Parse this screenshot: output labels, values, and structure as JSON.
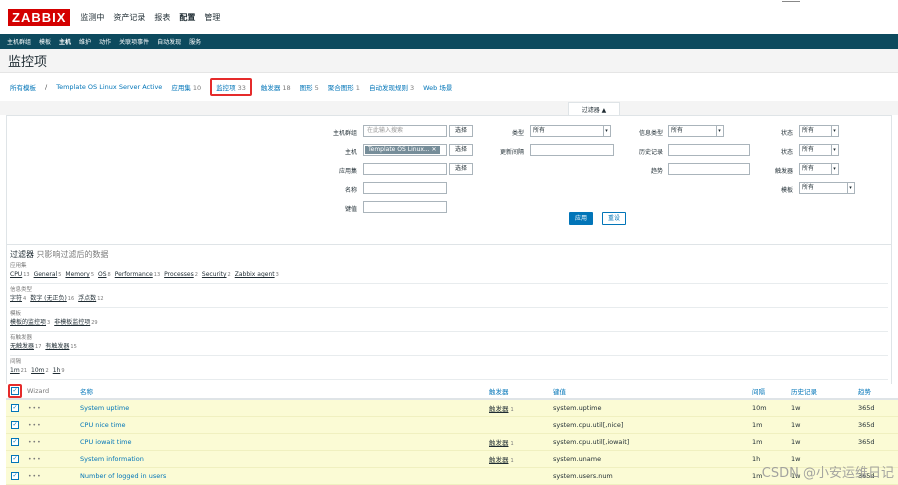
{
  "app": {
    "logo": "ZABBIX"
  },
  "main_menu": [
    "监测中",
    "资产记录",
    "报表",
    "配置",
    "管理"
  ],
  "main_menu_active": "配置",
  "sub_menu": [
    "主机群组",
    "模板",
    "主机",
    "维护",
    "动作",
    "关联项事件",
    "自动发现",
    "服务"
  ],
  "sub_menu_active": "主机",
  "page_title": "监控项",
  "breadcrumb": {
    "all_templates": "所有模板",
    "separator": "/",
    "template": "Template OS Linux Server Active"
  },
  "tabs": [
    {
      "label": "应用集",
      "count": "10"
    },
    {
      "label": "监控项",
      "count": "33"
    },
    {
      "label": "触发器",
      "count": "18"
    },
    {
      "label": "图形",
      "count": "5"
    },
    {
      "label": "聚合图形",
      "count": "1"
    },
    {
      "label": "自动发现规则",
      "count": "3"
    },
    {
      "label": "Web 场景",
      "count": ""
    }
  ],
  "filter": {
    "toggle_label": "过滤器 ▲",
    "host_group_label": "主机群组",
    "host_group_placeholder": "在此输入搜索",
    "select_label": "选择",
    "host_label": "主机",
    "host_chip": "Template OS Linux...",
    "app_label": "应用集",
    "name_label": "名称",
    "key_label": "键值",
    "type_label": "类型",
    "type_value": "所有",
    "interval_label": "更新间隔",
    "info_type_label": "信息类型",
    "info_type_value": "所有",
    "history_label": "历史记录",
    "trends_label": "趋势",
    "state_label": "状态",
    "state_value": "所有",
    "status_label": "状态",
    "status_value": "所有",
    "triggers_label": "触发器",
    "triggers_value": "所有",
    "template_label": "模板",
    "template_value": "所有",
    "apply_label": "应用",
    "reset_label": "重设"
  },
  "subfilter": {
    "title": "过滤器",
    "hint": "只影响过滤后的数据",
    "groups": [
      {
        "label": "应用集",
        "items": [
          {
            "name": "CPU",
            "count": "13"
          },
          {
            "name": "General",
            "count": "5"
          },
          {
            "name": "Memory",
            "count": "5"
          },
          {
            "name": "OS",
            "count": "8"
          },
          {
            "name": "Performance",
            "count": "13"
          },
          {
            "name": "Processes",
            "count": "2"
          },
          {
            "name": "Security",
            "count": "2"
          },
          {
            "name": "Zabbix agent",
            "count": "3"
          }
        ]
      },
      {
        "label": "信息类型",
        "items": [
          {
            "name": "字符",
            "count": "4"
          },
          {
            "name": "数字 (无正负)",
            "count": "16"
          },
          {
            "name": "浮点数",
            "count": "12"
          }
        ]
      },
      {
        "label": "模板",
        "items": [
          {
            "name": "模板的监控项",
            "count": "3"
          },
          {
            "name": "非模板监控项",
            "count": "29"
          }
        ]
      },
      {
        "label": "有触发器",
        "items": [
          {
            "name": "无触发器",
            "count": "17"
          },
          {
            "name": "有触发器",
            "count": "15"
          }
        ]
      },
      {
        "label": "间隔",
        "items": [
          {
            "name": "1m",
            "count": "21"
          },
          {
            "name": "10m",
            "count": "2"
          },
          {
            "name": "1h",
            "count": "9"
          }
        ]
      }
    ]
  },
  "table": {
    "headers": {
      "wizard": "Wizard",
      "name": "名称",
      "triggers": "触发器",
      "key": "键值",
      "interval": "间隔",
      "history": "历史记录",
      "trends": "趋势"
    },
    "rows": [
      {
        "name": "System uptime",
        "triggers": "触发器",
        "trig_count": "1",
        "key": "system.uptime",
        "interval": "10m",
        "history": "1w",
        "trends": "365d"
      },
      {
        "name": "CPU nice time",
        "triggers": "",
        "trig_count": "",
        "key": "system.cpu.util[,nice]",
        "interval": "1m",
        "history": "1w",
        "trends": "365d"
      },
      {
        "name": "CPU iowait time",
        "triggers": "触发器",
        "trig_count": "1",
        "key": "system.cpu.util[,iowait]",
        "interval": "1m",
        "history": "1w",
        "trends": "365d"
      },
      {
        "name": "System information",
        "triggers": "触发器",
        "trig_count": "1",
        "key": "system.uname",
        "interval": "1h",
        "history": "1w",
        "trends": ""
      },
      {
        "name": "Number of logged in users",
        "triggers": "",
        "trig_count": "",
        "key": "system.users.num",
        "interval": "1m",
        "history": "1w",
        "trends": "365d"
      }
    ]
  },
  "watermark": "CSDN @小安运维日记",
  "colors": {
    "brand": "#d40000",
    "nav": "#0d4a5e",
    "link": "#0275b8",
    "highlight_row": "#fbfbd5",
    "annotation": "#e52b2b"
  }
}
